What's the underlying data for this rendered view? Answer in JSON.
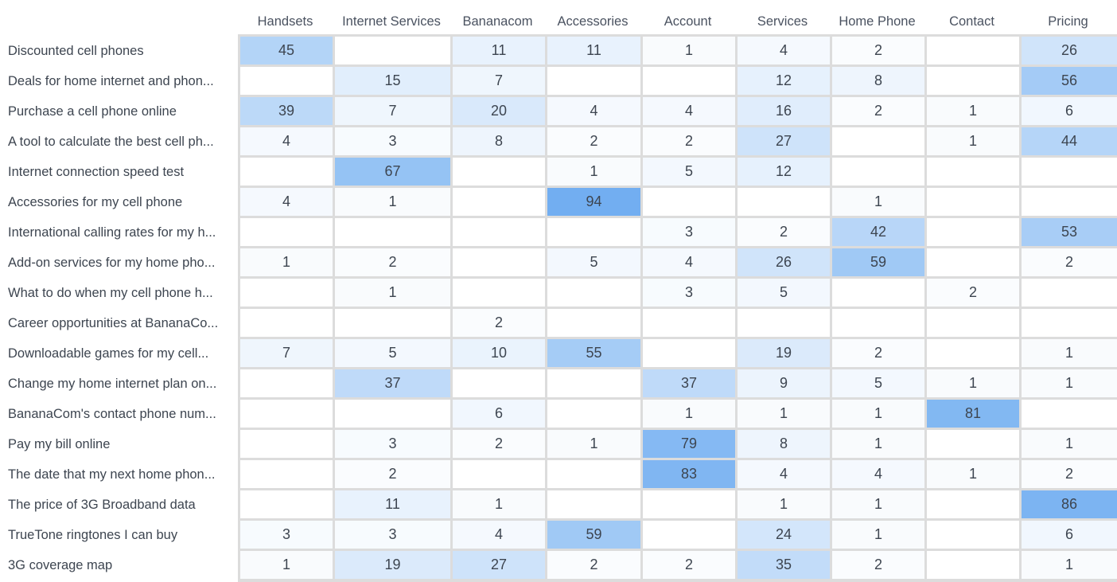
{
  "chart_data": {
    "type": "heatmap",
    "title": "",
    "columns": [
      "Handsets",
      "Internet Services",
      "Bananacom",
      "Accessories",
      "Account",
      "Services",
      "Home Phone",
      "Contact",
      "Pricing"
    ],
    "rows": [
      "Discounted cell phones",
      "Deals for home internet and phon...",
      "Purchase a cell phone online",
      "A tool to calculate the best cell ph...",
      "Internet connection speed test",
      "Accessories for my cell phone",
      "International calling rates for my h...",
      "Add-on services for my home pho...",
      "What to do when my cell phone h...",
      "Career opportunities at BananaCo...",
      "Downloadable games for my cell...",
      "Change my home internet plan on...",
      "BananaCom's contact phone num...",
      "Pay my bill online",
      "The date that my next home phon...",
      "The price of 3G Broadband data",
      "TrueTone ringtones I can buy",
      "3G coverage map"
    ],
    "values": [
      [
        45,
        null,
        11,
        11,
        1,
        4,
        2,
        null,
        26
      ],
      [
        null,
        15,
        7,
        null,
        null,
        12,
        8,
        null,
        56
      ],
      [
        39,
        7,
        20,
        4,
        4,
        16,
        2,
        1,
        6
      ],
      [
        4,
        3,
        8,
        2,
        2,
        27,
        null,
        1,
        44
      ],
      [
        null,
        67,
        null,
        1,
        5,
        12,
        null,
        null,
        null
      ],
      [
        4,
        1,
        null,
        94,
        null,
        null,
        1,
        null,
        null
      ],
      [
        null,
        null,
        null,
        null,
        3,
        2,
        42,
        null,
        53
      ],
      [
        1,
        2,
        null,
        5,
        4,
        26,
        59,
        null,
        2
      ],
      [
        null,
        1,
        null,
        null,
        3,
        5,
        null,
        2,
        null
      ],
      [
        null,
        null,
        2,
        null,
        null,
        null,
        null,
        null,
        null
      ],
      [
        7,
        5,
        10,
        55,
        null,
        19,
        2,
        null,
        1
      ],
      [
        null,
        37,
        null,
        null,
        37,
        9,
        5,
        1,
        1
      ],
      [
        null,
        null,
        6,
        null,
        1,
        1,
        1,
        81,
        null
      ],
      [
        null,
        3,
        2,
        1,
        79,
        8,
        1,
        null,
        1
      ],
      [
        null,
        2,
        null,
        null,
        83,
        4,
        4,
        1,
        2
      ],
      [
        null,
        11,
        1,
        null,
        null,
        1,
        1,
        null,
        86
      ],
      [
        3,
        3,
        4,
        59,
        null,
        24,
        1,
        null,
        6
      ],
      [
        1,
        19,
        27,
        2,
        2,
        35,
        2,
        null,
        1
      ]
    ],
    "value_range": [
      0,
      100
    ],
    "color_low": "#ffffff",
    "color_high": "#6aaaf0",
    "grid": true,
    "legend": "none"
  }
}
